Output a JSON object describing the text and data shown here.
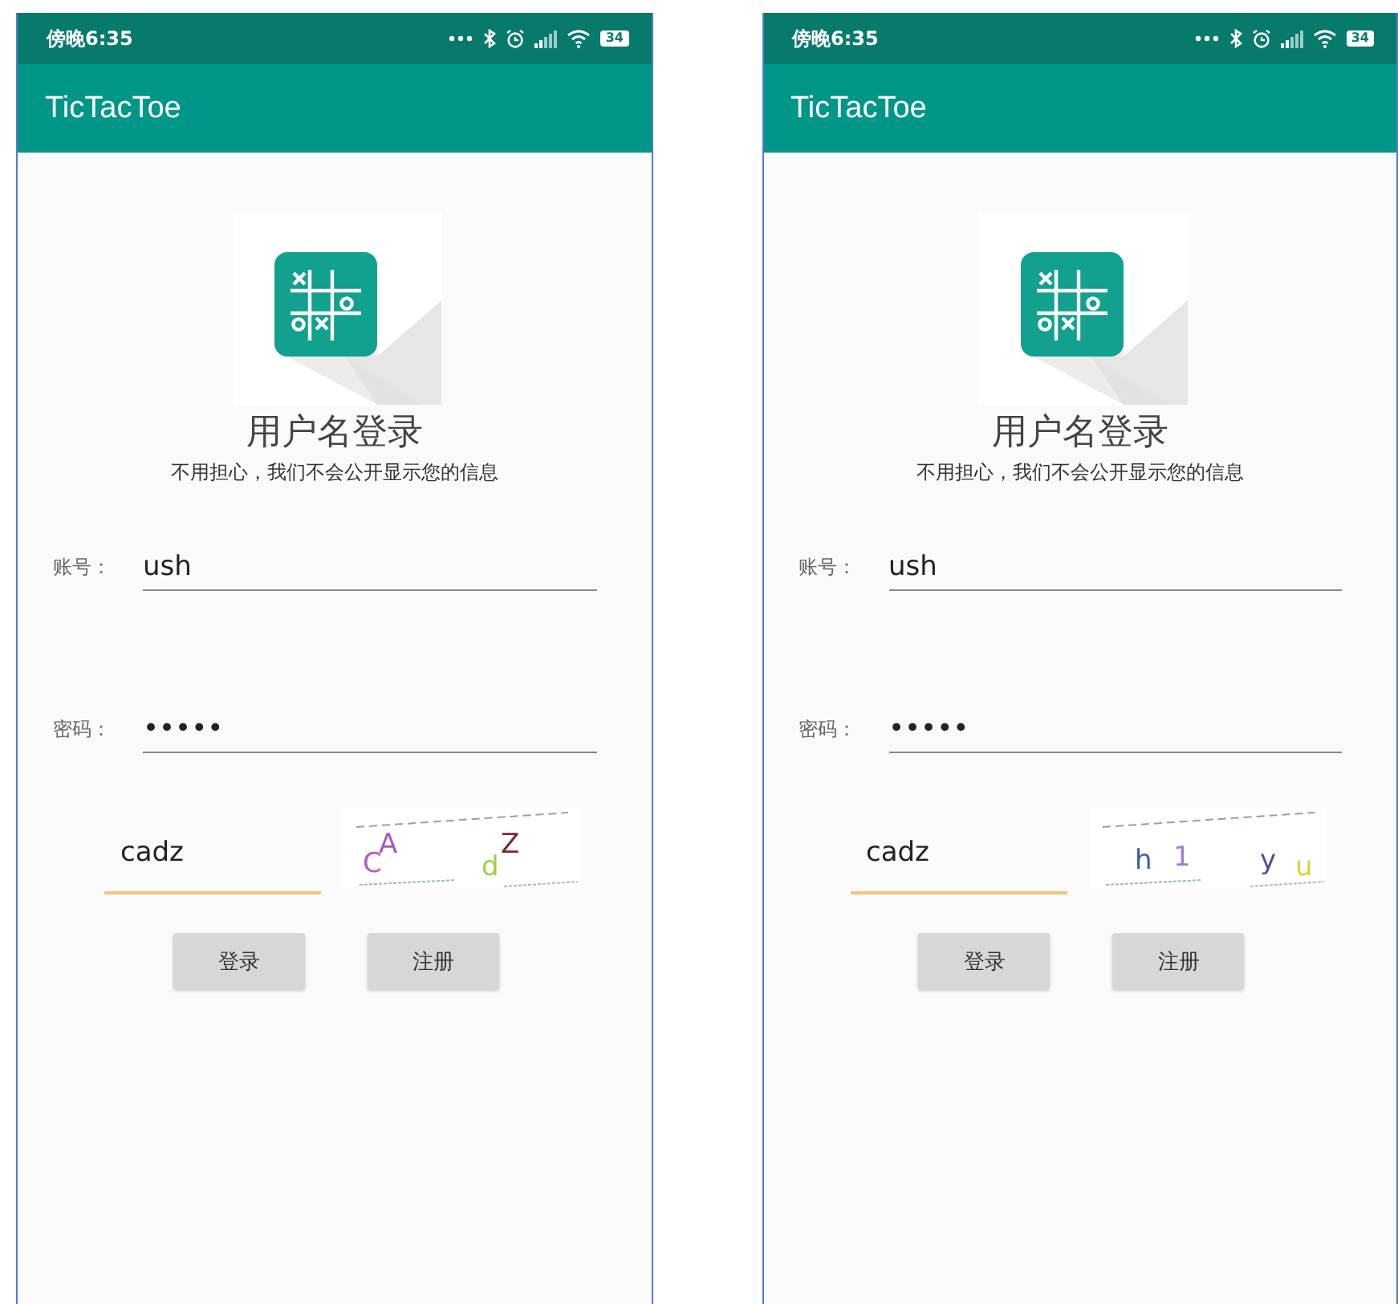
{
  "phones": [
    {
      "status_bar": {
        "time": "傍晚6:35",
        "battery": "34"
      },
      "app_bar": {
        "title": "TicTacToe"
      },
      "heading": "用户名登录",
      "subtitle": "不用担心，我们不会公开显示您的信息",
      "fields": [
        {
          "label": "账号：",
          "value": "ush"
        },
        {
          "label": "密码：",
          "value": "•••••"
        }
      ],
      "captcha": {
        "value": "cadz",
        "image_chars": [
          {
            "char": "C",
            "color": "#b65cc4"
          },
          {
            "char": "A",
            "color": "#a858c0"
          },
          {
            "char": "d",
            "color": "#9ccf48"
          },
          {
            "char": "Z",
            "color": "#7a2a30"
          }
        ]
      },
      "buttons": [
        "登录",
        "注册"
      ]
    },
    {
      "status_bar": {
        "time": "傍晚6:35",
        "battery": "34"
      },
      "app_bar": {
        "title": "TicTacToe"
      },
      "heading": "用户名登录",
      "subtitle": "不用担心，我们不会公开显示您的信息",
      "fields": [
        {
          "label": "账号：",
          "value": "ush"
        },
        {
          "label": "密码：",
          "value": "•••••"
        }
      ],
      "captcha": {
        "value": "cadz",
        "image_chars": [
          {
            "char": "h",
            "color": "#3a5cb0"
          },
          {
            "char": "1",
            "color": "#9c80d4"
          },
          {
            "char": "y",
            "color": "#554a98"
          },
          {
            "char": "u",
            "color": "#d6d43a"
          }
        ]
      },
      "buttons": [
        "登录",
        "注册"
      ]
    }
  ]
}
